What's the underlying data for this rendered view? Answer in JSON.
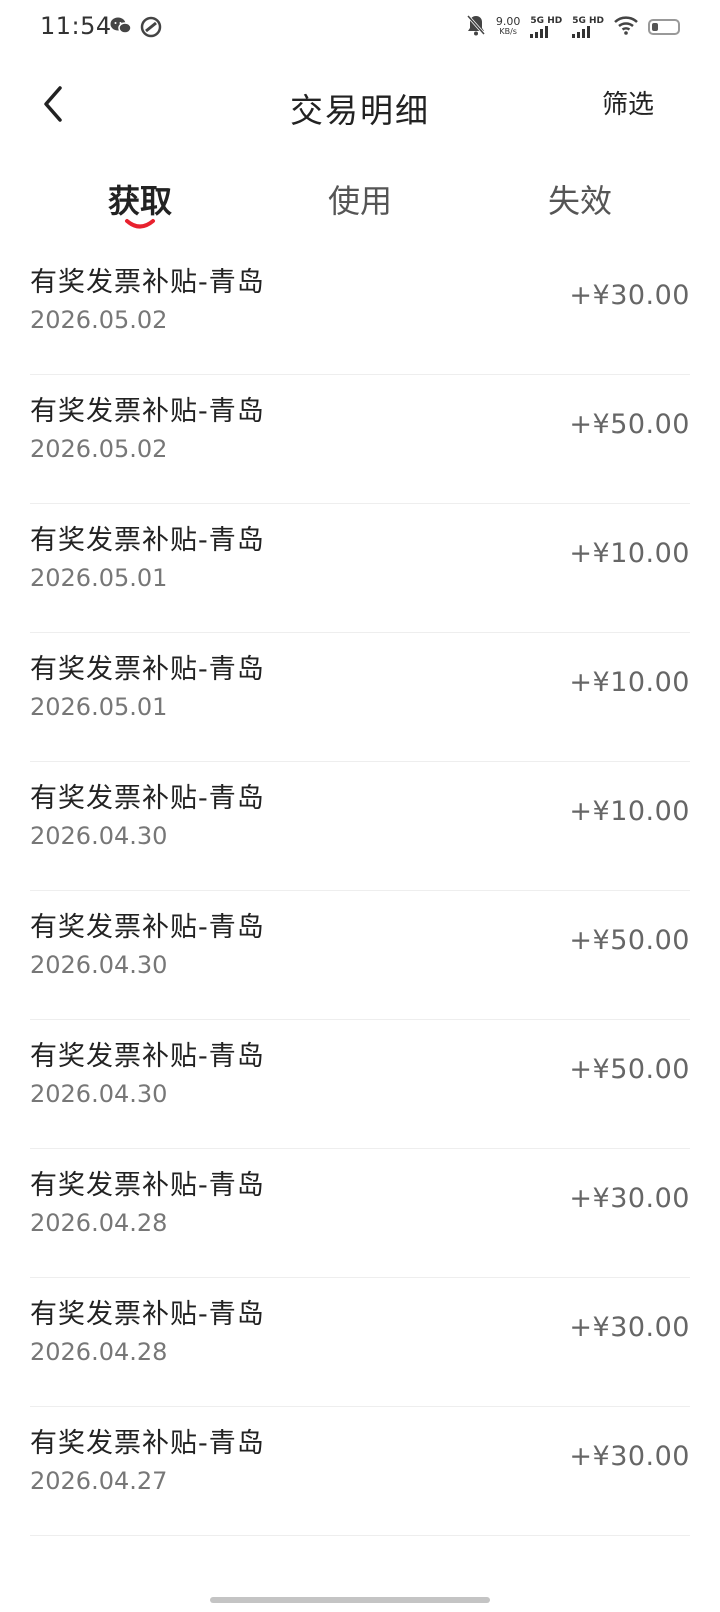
{
  "status_bar": {
    "time": "11:54",
    "net_speed_value": "9.00",
    "net_speed_unit": "KB/s",
    "signal1_label": "5G HD",
    "signal2_label": "5G HD",
    "icons": [
      "wechat-icon",
      "app-icon",
      "mute-bell-icon",
      "wifi-icon",
      "battery-icon"
    ]
  },
  "header": {
    "title": "交易明细",
    "filter_label": "筛选",
    "back_icon": "chevron-left-icon"
  },
  "tabs": [
    {
      "label": "获取",
      "active": true
    },
    {
      "label": "使用",
      "active": false
    },
    {
      "label": "失效",
      "active": false
    }
  ],
  "colors": {
    "accent": "#e8212e",
    "text_primary": "#222222",
    "text_secondary": "#777777",
    "amount": "#666666",
    "divider": "#eeeeee"
  },
  "transactions": [
    {
      "title": "有奖发票补贴-青岛",
      "date": "2026.05.02",
      "amount": "+¥30.00"
    },
    {
      "title": "有奖发票补贴-青岛",
      "date": "2026.05.02",
      "amount": "+¥50.00"
    },
    {
      "title": "有奖发票补贴-青岛",
      "date": "2026.05.01",
      "amount": "+¥10.00"
    },
    {
      "title": "有奖发票补贴-青岛",
      "date": "2026.05.01",
      "amount": "+¥10.00"
    },
    {
      "title": "有奖发票补贴-青岛",
      "date": "2026.04.30",
      "amount": "+¥10.00"
    },
    {
      "title": "有奖发票补贴-青岛",
      "date": "2026.04.30",
      "amount": "+¥50.00"
    },
    {
      "title": "有奖发票补贴-青岛",
      "date": "2026.04.30",
      "amount": "+¥50.00"
    },
    {
      "title": "有奖发票补贴-青岛",
      "date": "2026.04.28",
      "amount": "+¥30.00"
    },
    {
      "title": "有奖发票补贴-青岛",
      "date": "2026.04.28",
      "amount": "+¥30.00"
    },
    {
      "title": "有奖发票补贴-青岛",
      "date": "2026.04.27",
      "amount": "+¥30.00"
    }
  ]
}
